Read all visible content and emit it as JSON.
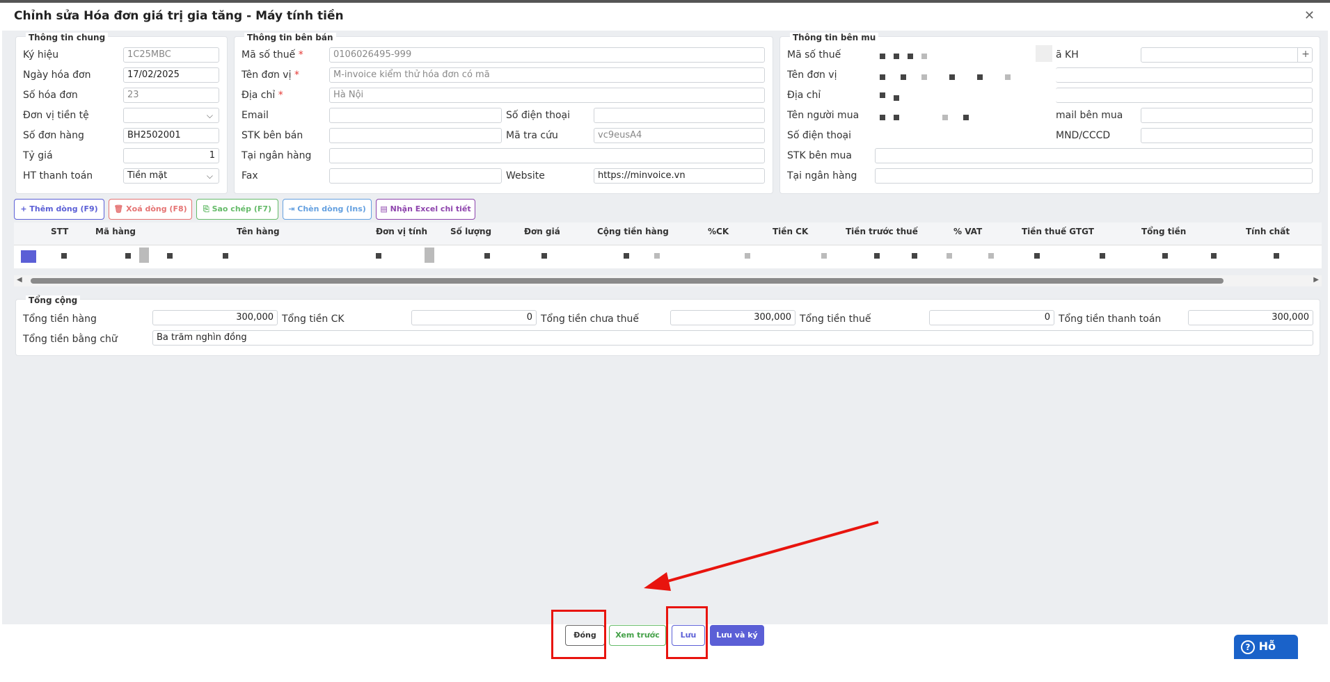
{
  "window": {
    "title": "Chỉnh sửa Hóa đơn giá trị gia tăng - Máy tính tiền"
  },
  "general": {
    "legend": "Thông tin chung",
    "fields": [
      {
        "label": "Ký hiệu",
        "value": "1C25MBC"
      },
      {
        "label": "Ngày hóa đơn",
        "value": "17/02/2025"
      },
      {
        "label": "Số hóa đơn",
        "value": "23"
      },
      {
        "label": "Đơn vị tiền tệ",
        "value": ""
      },
      {
        "label": "Số đơn hàng",
        "value": "BH2502001"
      },
      {
        "label": "Tỷ giá",
        "value": "1"
      },
      {
        "label": "HT thanh toán",
        "value": "Tiền mặt"
      }
    ]
  },
  "seller": {
    "legend": "Thông tin bên bán",
    "tax_label": "Mã số thuế",
    "tax_value": "0106026495-999",
    "unit_label": "Tên đơn vị",
    "unit_value": "M-invoice kiểm thử hóa đơn có mã",
    "addr_label": "Địa chỉ",
    "addr_value": "Hà Nội",
    "email_label": "Email",
    "email_value": "",
    "phone_label": "Số điện thoại",
    "phone_value": "",
    "acct_label": "STK bên bán",
    "acct_value": "",
    "lookup_label": "Mã tra cứu",
    "lookup_value": "vc9eusA4",
    "bank_label": "Tại ngân hàng",
    "bank_value": "",
    "fax_label": "Fax",
    "fax_value": "",
    "web_label": "Website",
    "web_value": "https://minvoice.vn"
  },
  "buyer": {
    "legend": "Thông tin bên mu",
    "tax_label": "Mã số thuế",
    "customer_code_label": "ã KH",
    "unit_label": "Tên đơn vị",
    "addr_label": "Địa chỉ",
    "buyer_name_label": "Tên người mua",
    "email_label": "mail bên mua",
    "phone_label": "Số điện thoại",
    "id_label": "MND/CCCD",
    "acct_label": "STK bên mua",
    "bank_label": "Tại ngân hàng",
    "plus": "+"
  },
  "toolbar": [
    {
      "label": "Thêm dòng (F9)",
      "icon": "+",
      "color": "#5b5fd6"
    },
    {
      "label": "Xoá dòng (F8)",
      "icon": "🗑",
      "color": "#e57373"
    },
    {
      "label": "Sao chép (F7)",
      "icon": "⎘",
      "color": "#66bb6a"
    },
    {
      "label": "Chèn dòng (Ins)",
      "icon": "⇥",
      "color": "#64a0e0"
    },
    {
      "label": "Nhận Excel chi tiết",
      "icon": "▤",
      "color": "#8e44ad"
    }
  ],
  "grid_columns": [
    "STT",
    "Mã hàng",
    "Tên hàng",
    "Đơn vị tính",
    "Số lượng",
    "Đơn giá",
    "Cộng tiền hàng",
    "%CK",
    "Tiền CK",
    "Tiền trước thuế",
    "% VAT",
    "Tiền thuế GTGT",
    "Tổng tiền",
    "Tính chất"
  ],
  "totals": {
    "legend": "Tổng cộng",
    "goods_label": "Tổng tiền hàng",
    "goods_value": "300,000",
    "discount_label": "Tổng tiền CK",
    "discount_value": "0",
    "pretax_label": "Tổng tiền chưa thuế",
    "pretax_value": "300,000",
    "tax_label": "Tổng tiền thuế",
    "tax_value": "0",
    "pay_label": "Tổng tiền thanh toán",
    "pay_value": "300,000",
    "words_label": "Tổng tiền bằng chữ",
    "words_value": "Ba trăm nghìn đồng"
  },
  "footer": {
    "close": "Đóng",
    "preview": "Xem trước",
    "save": "Lưu",
    "save_sign": "Lưu và ký",
    "support": "Hỗ trợ"
  },
  "colors": {
    "accent": "#5b5fd6",
    "annotation": "#e8140e",
    "support": "#1a62c9"
  }
}
